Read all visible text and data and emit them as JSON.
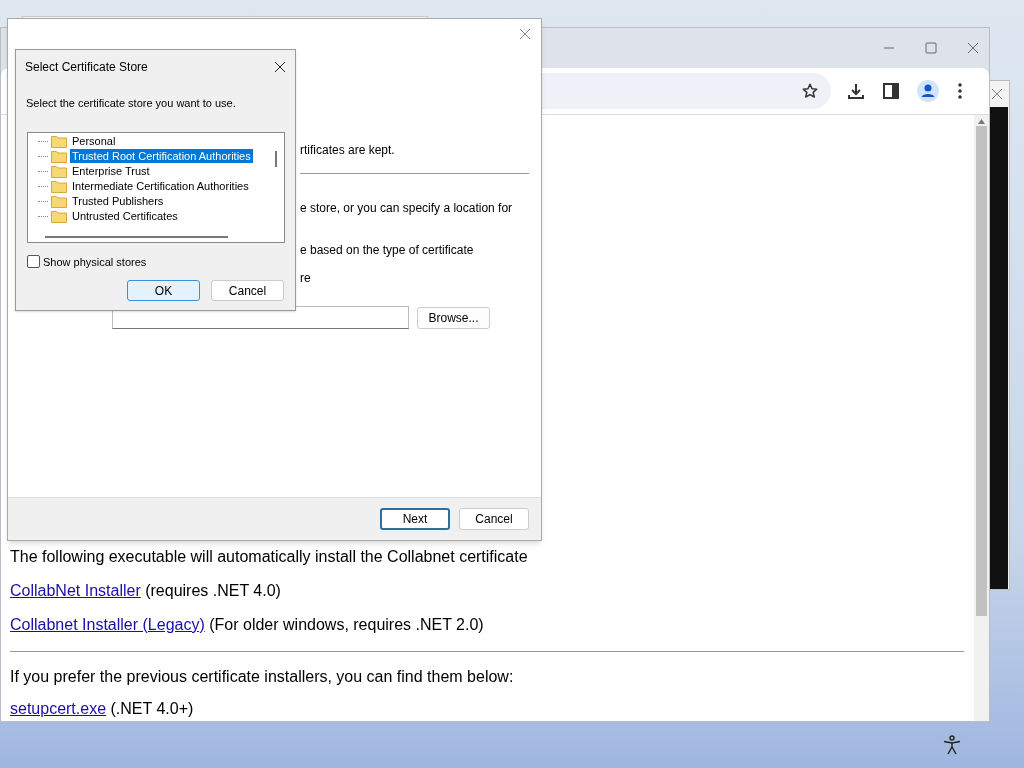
{
  "browser": {
    "content": {
      "intro": "The following executable will automatically install the Collabnet certificate",
      "links": [
        {
          "link": "CollabNet Installer",
          "note": "(requires .NET 4.0)"
        },
        {
          "link": "Collabnet Installer (Legacy)",
          "note": "(For older windows, requires .NET 2.0)"
        }
      ],
      "previous_intro": "If you prefer the previous certificate installers, you can find them below:",
      "previous_links": [
        {
          "link": "setupcert.exe",
          "note": "(.NET 4.0+)"
        }
      ]
    }
  },
  "wizard": {
    "texts": [
      "rtificates are kept.",
      "e store, or you can specify a location for",
      "e based on the type of certificate",
      "re"
    ],
    "browse_button": "Browse...",
    "next_button": "Next",
    "cancel_button": "Cancel"
  },
  "store_dialog": {
    "title": "Select Certificate Store",
    "instruction": "Select the certificate store you want to use.",
    "stores": [
      {
        "label": "Personal",
        "selected": false
      },
      {
        "label": "Trusted Root Certification Authorities",
        "selected": true
      },
      {
        "label": "Enterprise Trust",
        "selected": false
      },
      {
        "label": "Intermediate Certification Authorities",
        "selected": false
      },
      {
        "label": "Trusted Publishers",
        "selected": false
      },
      {
        "label": "Untrusted Certificates",
        "selected": false
      }
    ],
    "show_physical_stores": {
      "label": "Show physical stores",
      "checked": false
    },
    "buttons": [
      "OK",
      "Cancel"
    ]
  }
}
